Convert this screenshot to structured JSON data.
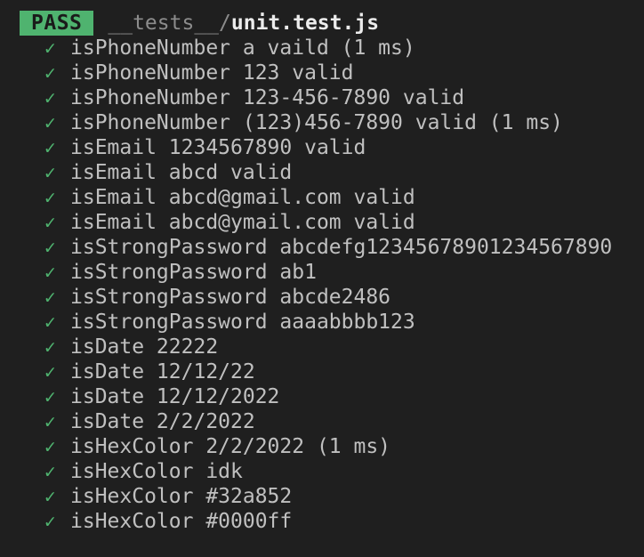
{
  "status_badge": "PASS",
  "file_path": {
    "dir": "__tests__/",
    "file": "unit.test.js"
  },
  "check_glyph": "✓",
  "colors": {
    "background": "#1f1f1f",
    "pass_green": "#4fb36f",
    "text": "#c0c0c0"
  },
  "tests": [
    "isPhoneNumber a vaild (1 ms)",
    "isPhoneNumber 123 valid",
    "isPhoneNumber 123-456-7890 valid",
    "isPhoneNumber (123)456-7890 valid (1 ms)",
    "isEmail 1234567890 valid",
    "isEmail abcd valid",
    "isEmail abcd@gmail.com valid",
    "isEmail abcd@ymail.com valid",
    "isStrongPassword abcdefg12345678901234567890",
    "isStrongPassword ab1",
    "isStrongPassword abcde2486",
    "isStrongPassword aaaabbbb123",
    "isDate 22222",
    "isDate 12/12/22",
    "isDate 12/12/2022",
    "isDate 2/2/2022",
    "isHexColor 2/2/2022 (1 ms)",
    "isHexColor idk",
    "isHexColor #32a852",
    "isHexColor #0000ff"
  ]
}
